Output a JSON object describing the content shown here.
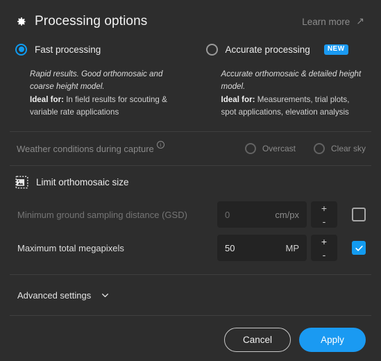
{
  "header": {
    "title": "Processing options",
    "gear_icon": "gear-icon",
    "learn_more_label": "Learn more",
    "learn_more_icon": "arrow-up-right-icon"
  },
  "processing_options": {
    "fast": {
      "label": "Fast processing",
      "selected": true,
      "desc_italic": "Rapid results. Good orthomosaic and coarse height model.",
      "desc_bold_prefix": "Ideal for:",
      "desc_rest": " In field results for scouting & variable rate applications"
    },
    "accurate": {
      "label": "Accurate processing",
      "selected": false,
      "badge": "NEW",
      "desc_italic": "Accurate orthomosaic & detailed height model.",
      "desc_bold_prefix": "Ideal for:",
      "desc_rest": " Measurements, trial plots, spot applications, elevation analysis"
    }
  },
  "weather": {
    "label": "Weather conditions during capture",
    "info_icon": "info-icon",
    "info_glyph": "i",
    "options": [
      {
        "label": "Overcast",
        "selected": false
      },
      {
        "label": "Clear sky",
        "selected": false
      }
    ]
  },
  "limit_orthomosaic": {
    "title": "Limit orthomosaic size",
    "icon": "crop-image-icon",
    "fields": [
      {
        "label": "Minimum ground sampling distance (GSD)",
        "value": "0",
        "unit": "cm/px",
        "enabled": false,
        "checked": false,
        "increment_label": "+",
        "decrement_label": "-"
      },
      {
        "label": "Maximum total megapixels",
        "value": "50",
        "unit": "MP",
        "enabled": true,
        "checked": true,
        "increment_label": "+",
        "decrement_label": "-"
      }
    ]
  },
  "advanced": {
    "label": "Advanced settings",
    "chevron_icon": "chevron-down-icon",
    "expanded": false
  },
  "footer": {
    "cancel_label": "Cancel",
    "apply_label": "Apply"
  },
  "colors": {
    "background": "#2d2d2d",
    "accent": "#1a9af2",
    "radio_accent": "#0f9bf0",
    "input_background": "#232323",
    "divider": "#3f3f3f",
    "text_primary": "#ececec",
    "text_muted": "#8a8a8a"
  }
}
